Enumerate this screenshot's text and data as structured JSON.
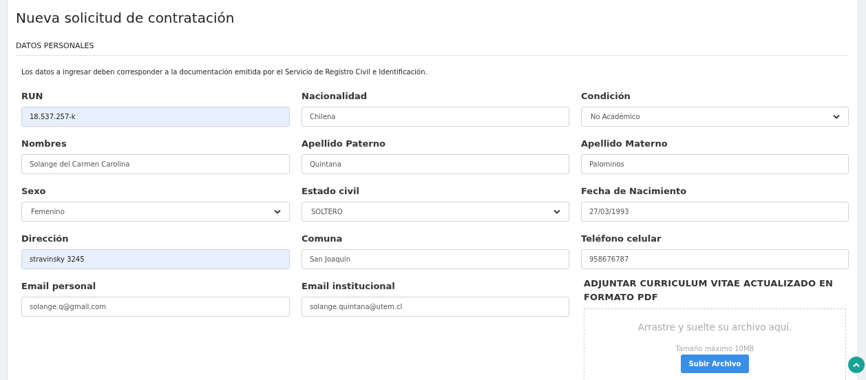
{
  "title": "Nueva solicitud de contratación",
  "section": "DATOS PERSONALES",
  "note": "Los datos a ingresar deben corresponder a la documentación emitida por el Servicio de Registro Civil e Identificación.",
  "fields": [
    {
      "label": "RUN",
      "kind": "text",
      "value": "18.537.257-k",
      "autofilled": true
    },
    {
      "label": "Nacionalidad",
      "kind": "text",
      "value": "Chilena",
      "autofilled": false
    },
    {
      "label": "Condición",
      "kind": "select",
      "value": "No Académico",
      "autofilled": false
    },
    {
      "label": "Nombres",
      "kind": "text",
      "value": "Solange del Carmen Carolina",
      "autofilled": false
    },
    {
      "label": "Apellido Paterno",
      "kind": "text",
      "value": "Quintana",
      "autofilled": false
    },
    {
      "label": "Apellido Materno",
      "kind": "text",
      "value": "Palominos",
      "autofilled": false
    },
    {
      "label": "Sexo",
      "kind": "select",
      "value": "Femenino",
      "autofilled": false
    },
    {
      "label": "Estado civil",
      "kind": "select",
      "value": "SOLTERO",
      "autofilled": false
    },
    {
      "label": "Fecha de Nacimiento",
      "kind": "text",
      "value": "27/03/1993",
      "autofilled": false
    },
    {
      "label": "Dirección",
      "kind": "text",
      "value": "stravinsky 3245",
      "autofilled": true
    },
    {
      "label": "Comuna",
      "kind": "text",
      "value": "San Joaquín",
      "autofilled": false
    },
    {
      "label": "Teléfono celular",
      "kind": "text",
      "value": "958676787",
      "autofilled": false
    },
    {
      "label": "Email personal",
      "kind": "text",
      "value": "solange.q@gmail.com",
      "autofilled": false
    },
    {
      "label": "Email institucional",
      "kind": "text",
      "value": "solange.quintana@utem.cl",
      "autofilled": false
    }
  ],
  "upload": {
    "heading": "ADJUNTAR CURRICULUM VITAE ACTUALIZADO EN FORMATO PDF",
    "drop_hint": "Arrastre y suelte su archivo aquí.",
    "max_size": "Tamaño máximo 10MB",
    "button": "Subir Archivo"
  }
}
